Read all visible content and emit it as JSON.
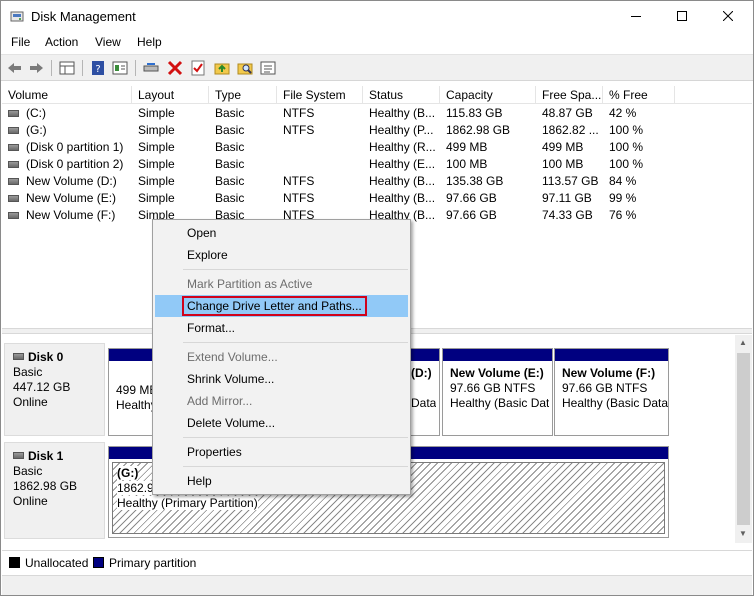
{
  "window": {
    "title": "Disk Management"
  },
  "menu": [
    "File",
    "Action",
    "View",
    "Help"
  ],
  "toolbar_icons": [
    "back-arrow-icon",
    "forward-arrow-icon",
    "grid-icon",
    "help-book-icon",
    "properties-icon",
    "connect-icon",
    "delete-x-icon",
    "checklist-icon",
    "folder-up-icon",
    "folder-search-icon",
    "list-icon"
  ],
  "volume_table": {
    "columns": [
      "Volume",
      "Layout",
      "Type",
      "File System",
      "Status",
      "Capacity",
      "Free Spa...",
      "% Free"
    ],
    "rows": [
      [
        "(C:)",
        "Simple",
        "Basic",
        "NTFS",
        "Healthy (B...",
        "115.83 GB",
        "48.87 GB",
        "42 %"
      ],
      [
        "(G:)",
        "Simple",
        "Basic",
        "NTFS",
        "Healthy (P...",
        "1862.98 GB",
        "1862.82 ...",
        "100 %"
      ],
      [
        "(Disk 0 partition 1)",
        "Simple",
        "Basic",
        "",
        "Healthy (R...",
        "499 MB",
        "499 MB",
        "100 %"
      ],
      [
        "(Disk 0 partition 2)",
        "Simple",
        "Basic",
        "",
        "Healthy (E...",
        "100 MB",
        "100 MB",
        "100 %"
      ],
      [
        "New Volume (D:)",
        "Simple",
        "Basic",
        "NTFS",
        "Healthy (B...",
        "135.38 GB",
        "113.57 GB",
        "84 %"
      ],
      [
        "New Volume (E:)",
        "Simple",
        "Basic",
        "NTFS",
        "Healthy (B...",
        "97.66 GB",
        "97.11 GB",
        "99 %"
      ],
      [
        "New Volume (F:)",
        "Simple",
        "Basic",
        "NTFS",
        "Healthy (B...",
        "97.66 GB",
        "74.33 GB",
        "76 %"
      ]
    ]
  },
  "disks": [
    {
      "name": "Disk 0",
      "type": "Basic",
      "size": "447.12 GB",
      "state": "Online",
      "partitions": [
        {
          "line1": "",
          "line2": "499 MB",
          "line3": "Healthy"
        },
        {
          "line1": "(D:)",
          "line2": "",
          "line3": "Data"
        },
        {
          "line1": "New Volume  (E:)",
          "line2": "97.66 GB NTFS",
          "line3": "Healthy (Basic Dat"
        },
        {
          "line1": "New Volume  (F:)",
          "line2": "97.66 GB NTFS",
          "line3": "Healthy (Basic Data"
        }
      ]
    },
    {
      "name": "Disk 1",
      "type": "Basic",
      "size": "1862.98 GB",
      "state": "Online",
      "partitions": [
        {
          "line1": "(G:)",
          "line2": "1862.98",
          "line3": "Healthy (Primary Partition)"
        }
      ]
    }
  ],
  "legend": [
    {
      "label": "Unallocated",
      "color": "#000000"
    },
    {
      "label": "Primary partition",
      "color": "#000080"
    }
  ],
  "context_menu": {
    "items": [
      {
        "label": "Open",
        "enabled": true
      },
      {
        "label": "Explore",
        "enabled": true
      },
      {
        "label": "Mark Partition as Active",
        "enabled": false
      },
      {
        "label": "Change Drive Letter and Paths...",
        "enabled": true,
        "highlighted": true
      },
      {
        "label": "Format...",
        "enabled": true
      },
      {
        "label": "Extend Volume...",
        "enabled": false
      },
      {
        "label": "Shrink Volume...",
        "enabled": true
      },
      {
        "label": "Add Mirror...",
        "enabled": false
      },
      {
        "label": "Delete Volume...",
        "enabled": true
      },
      {
        "label": "Properties",
        "enabled": true
      },
      {
        "label": "Help",
        "enabled": true
      }
    ]
  },
  "colors": {
    "primary_partition": "#000080",
    "menu_highlight": "#91c9f7",
    "annotation_box": "#d0021b"
  }
}
